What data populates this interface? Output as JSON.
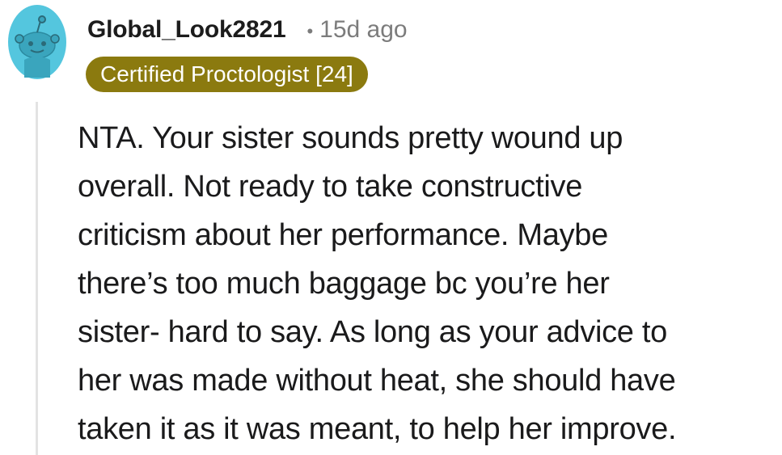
{
  "comment": {
    "author": "Global_Look2821",
    "separator": "•",
    "time": "15d ago",
    "flair": "Certified Proctologist [24]",
    "avatar_icon": "reddit-snoo-avatar-icon",
    "body_lines": [
      "NTA. Your sister sounds pretty wound up",
      "overall. Not ready to take constructive",
      "criticism about her performance. Maybe",
      "there’s too much baggage bc you’re her",
      "sister- hard to say. As long as your advice to",
      "her was made without heat, she should have",
      "taken it as it was meant, to help her improve."
    ]
  },
  "colors": {
    "avatar_bg": "#54c6de",
    "flair_bg": "#8b7a0f",
    "text": "#1a1a1b",
    "meta": "#7c7c7c",
    "thread_line": "#e3e3e3"
  }
}
